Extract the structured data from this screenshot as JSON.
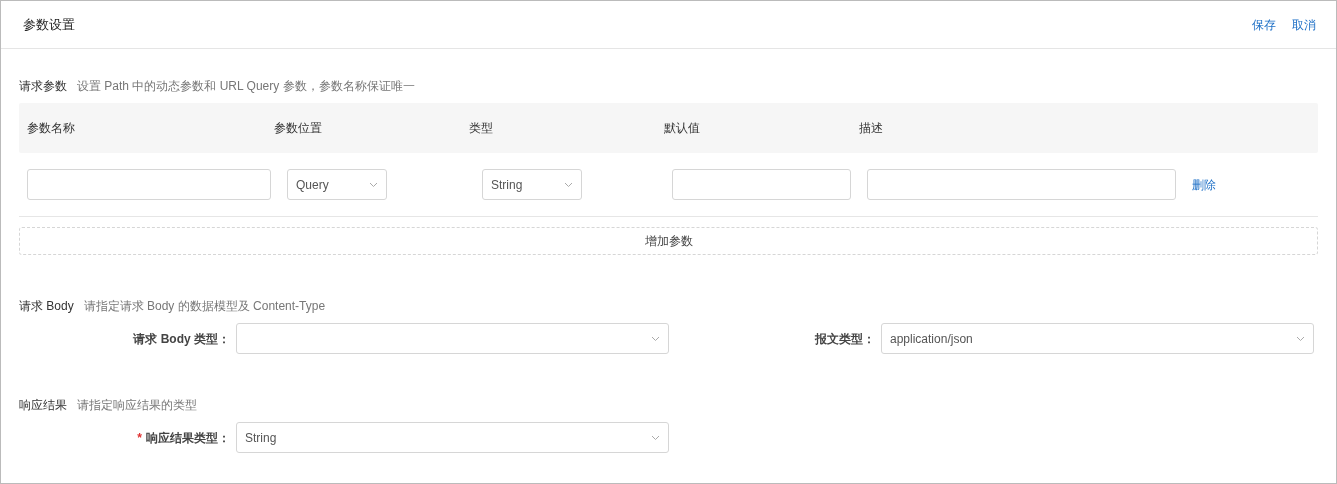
{
  "header": {
    "title": "参数设置",
    "actions": [
      {
        "label": "保存"
      },
      {
        "label": "取消"
      }
    ]
  },
  "request_params": {
    "title": "请求参数",
    "description": "设置 Path 中的动态参数和 URL Query 参数，参数名称保证唯一",
    "columns": [
      "参数名称",
      "参数位置",
      "类型",
      "默认值",
      "描述"
    ],
    "rows": [
      {
        "location": "Query",
        "type": "String",
        "action": "删除"
      }
    ],
    "add_button": "增加参数"
  },
  "request_body": {
    "title": "请求 Body",
    "description": "请指定请求 Body 的数据模型及 Content-Type",
    "fields": [
      {
        "label": "请求 Body 类型："
      },
      {
        "label": "报文类型：",
        "value": "application/json"
      }
    ]
  },
  "response": {
    "title": "响应结果",
    "description": "请指定响应结果的类型",
    "fields": [
      {
        "label": "响应结果类型：",
        "value": "String",
        "required_mark": "*"
      }
    ]
  }
}
